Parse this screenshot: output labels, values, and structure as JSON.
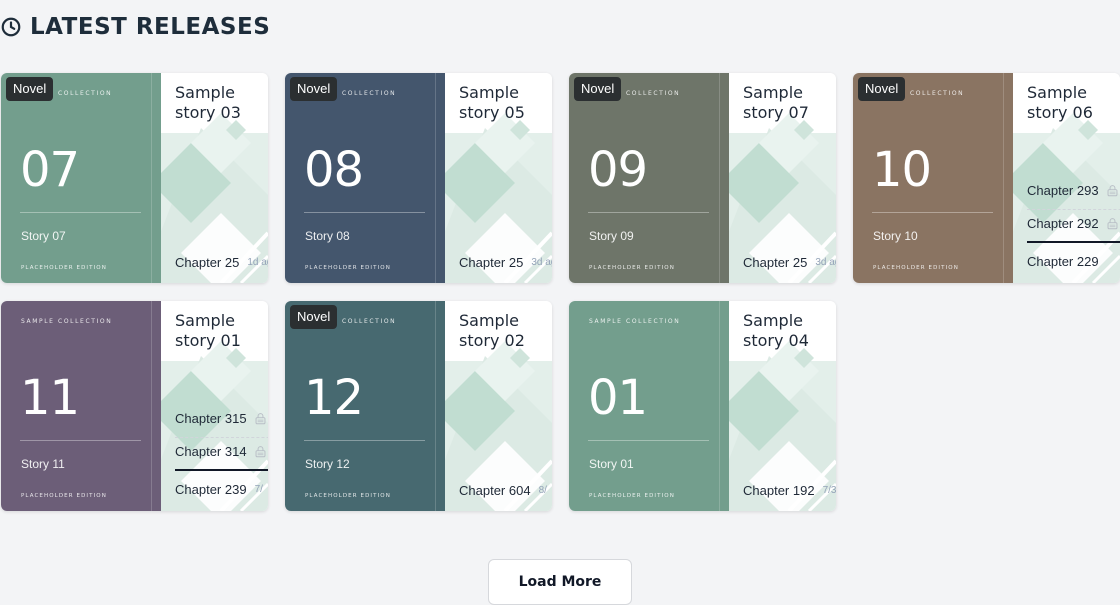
{
  "section": {
    "title": "LATEST RELEASES",
    "icon": "clock-icon"
  },
  "cards": [
    {
      "badge": "Novel",
      "collection": "COLLECTION",
      "number": "07",
      "story": "Story 07",
      "edition": "PLACEHOLDER EDITION",
      "cover_color": "#739e8d",
      "title": "Sample story 03",
      "chapters": [
        {
          "label": "Chapter 25",
          "time": "1d ago"
        }
      ]
    },
    {
      "badge": "Novel",
      "collection": "COLLECTION",
      "number": "08",
      "story": "Story 08",
      "edition": "PLACEHOLDER EDITION",
      "cover_color": "#44566d",
      "title": "Sample story 05",
      "chapters": [
        {
          "label": "Chapter 25",
          "time": "3d ago"
        }
      ]
    },
    {
      "badge": "Novel",
      "collection": "COLLECTION",
      "number": "09",
      "story": "Story 09",
      "edition": "PLACEHOLDER EDITION",
      "cover_color": "#6e7569",
      "title": "Sample story 07",
      "chapters": [
        {
          "label": "Chapter 25",
          "time": "3d ago"
        }
      ]
    },
    {
      "badge": "Novel",
      "collection": "COLLECTION",
      "number": "10",
      "story": "Story 10",
      "edition": "PLACEHOLDER EDITION",
      "cover_color": "#8a7462",
      "title": "Sample story 06",
      "chapters": [
        {
          "label": "Chapter 293",
          "locked": true
        },
        {
          "label": "Chapter 292",
          "locked": true
        },
        {
          "label": "Chapter 229",
          "time": ""
        }
      ]
    },
    {
      "badge": "",
      "collection": "SAMPLE COLLECTION",
      "number": "11",
      "story": "Story 11",
      "edition": "PLACEHOLDER EDITION",
      "cover_color": "#6c5e78",
      "title": "Sample story 01",
      "chapters": [
        {
          "label": "Chapter 315",
          "locked": true
        },
        {
          "label": "Chapter 314",
          "locked": true
        },
        {
          "label": "Chapter 239",
          "time": "7/"
        }
      ]
    },
    {
      "badge": "Novel",
      "collection": "COLLECTION",
      "number": "12",
      "story": "Story 12",
      "edition": "PLACEHOLDER EDITION",
      "cover_color": "#476970",
      "title": "Sample story 02",
      "chapters": [
        {
          "label": "Chapter 604",
          "time": "8/"
        }
      ]
    },
    {
      "badge": "",
      "collection": "SAMPLE COLLECTION",
      "number": "01",
      "story": "Story 01",
      "edition": "PLACEHOLDER EDITION",
      "cover_color": "#739e8d",
      "title": "Sample story 04",
      "chapters": [
        {
          "label": "Chapter 192",
          "time": "7/3"
        }
      ]
    }
  ],
  "load_more": {
    "label": "Load More"
  }
}
